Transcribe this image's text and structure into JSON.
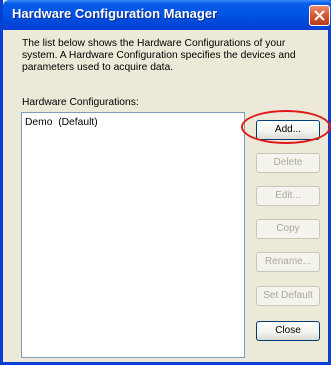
{
  "window": {
    "title": "Hardware Configuration Manager"
  },
  "content": {
    "description": "The list below shows the Hardware Configurations of your system. A Hardware Configuration specifies the devices and parameters used to acquire data.",
    "list_label": "Hardware Configurations:",
    "items": [
      {
        "label": "Demo  (Default)"
      }
    ]
  },
  "buttons": {
    "add": "Add...",
    "delete": "Delete",
    "edit": "Edit...",
    "copy": "Copy",
    "rename": "Rename...",
    "set_default": "Set Default",
    "close": "Close"
  },
  "colors": {
    "title_bar": "#0055e5",
    "dialog_bg": "#ece9d8",
    "annotation": "#e01818"
  },
  "icons": {
    "close": "close-icon"
  }
}
